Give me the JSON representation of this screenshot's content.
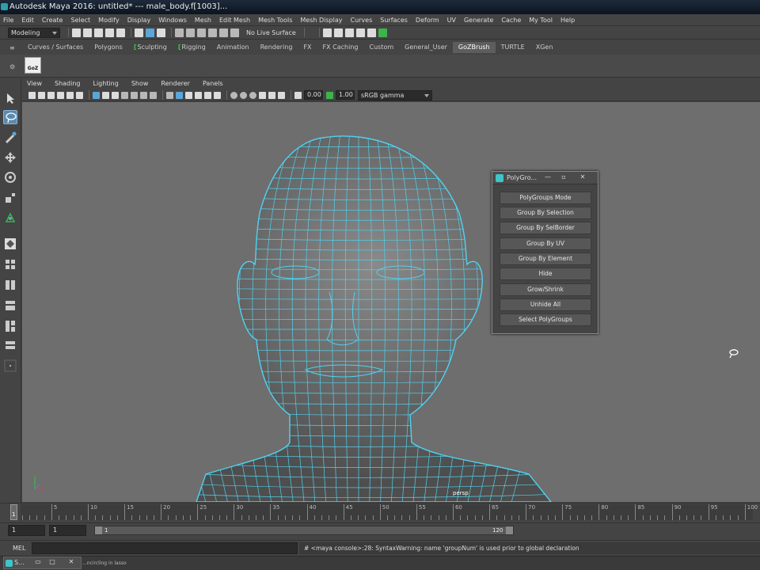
{
  "window": {
    "title": "Autodesk Maya 2016: untitled*   ---   male_body.f[1003]..."
  },
  "menubar": {
    "items": [
      "File",
      "Edit",
      "Create",
      "Select",
      "Modify",
      "Display",
      "Windows",
      "Mesh",
      "Edit Mesh",
      "Mesh Tools",
      "Mesh Display",
      "Curves",
      "Surfaces",
      "Deform",
      "UV",
      "Generate",
      "Cache",
      "My Tool",
      "Help"
    ]
  },
  "statusline": {
    "mode": "Modeling",
    "live_surface": "No Live Surface"
  },
  "shelf": {
    "tabs": [
      "Curves / Surfaces",
      "Polygons",
      "Sculpting",
      "Rigging",
      "Animation",
      "Rendering",
      "FX",
      "FX Caching",
      "Custom",
      "General_User",
      "GoZBrush",
      "TURTLE",
      "XGen"
    ],
    "active_tab": "GoZBrush",
    "goz_icon_label": "GoZ"
  },
  "panel": {
    "menu": [
      "View",
      "Shading",
      "Lighting",
      "Show",
      "Renderer",
      "Panels"
    ],
    "exposure": "0.00",
    "gamma": "1.00",
    "colorspace": "sRGB gamma",
    "camera_label": "persp"
  },
  "polygroups_window": {
    "title": "PolyGro...",
    "buttons": [
      "PolyGroups Mode",
      "Group By Selection",
      "Group By SelBorder",
      "Group By UV",
      "Group By Element",
      "Hide",
      "Grow/Shrink",
      "Unhide All",
      "Select PolyGroups"
    ]
  },
  "timeslider": {
    "current_frame": "1",
    "tick_labels": [
      "5",
      "10",
      "15",
      "20",
      "25",
      "30",
      "35",
      "40",
      "45",
      "50",
      "55",
      "60",
      "65",
      "70",
      "75",
      "80",
      "85",
      "90",
      "95",
      "100"
    ]
  },
  "range": {
    "start": "1",
    "playback_start": "1",
    "range_start": "1",
    "range_end": "120"
  },
  "commandline": {
    "label": "MEL",
    "result": "# <maya console>:28: SyntaxWarning: name 'groupNum' is used prior to global declaration"
  },
  "helpline": {
    "text": "...ncircling in lasso",
    "minimized_window_title": "S..."
  },
  "colors": {
    "wireframe": "#4fd2f0",
    "viewport_bg": "#6e6e6e",
    "accent_green": "#2ecc40"
  }
}
